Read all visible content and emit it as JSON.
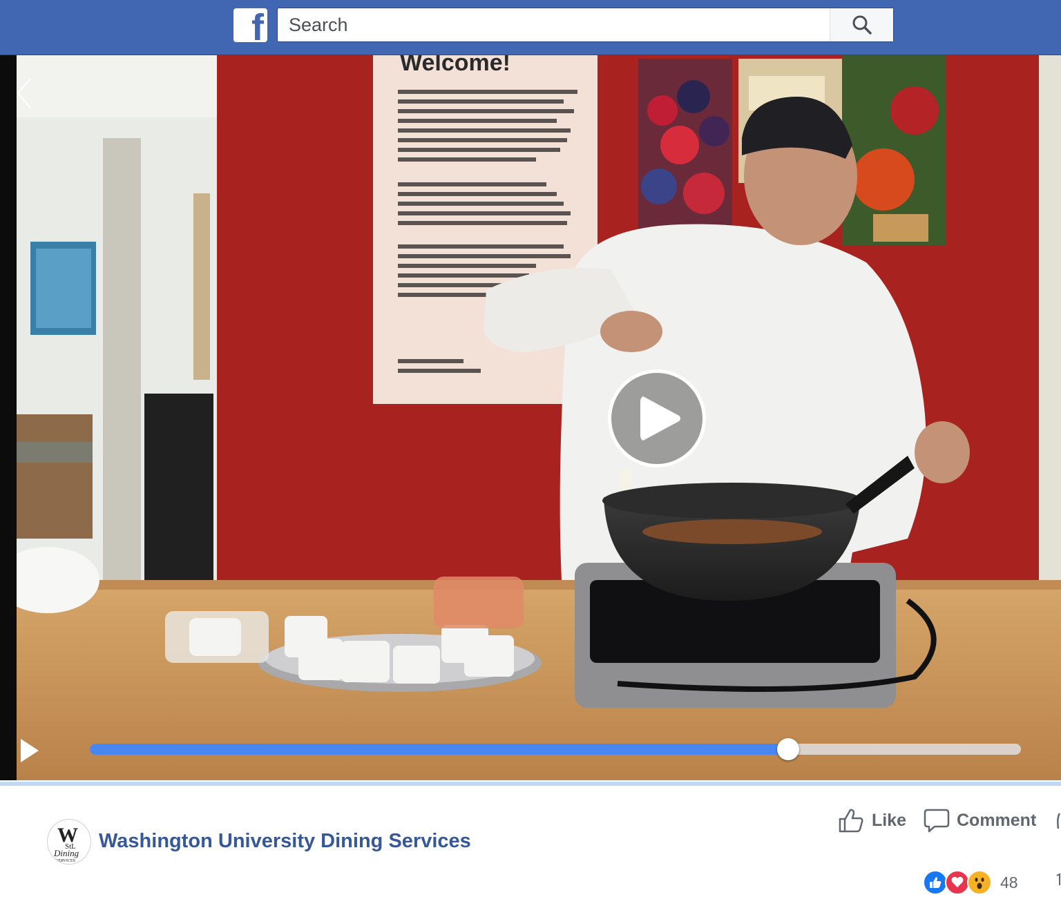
{
  "topbar": {
    "logo_glyph": "f",
    "search": {
      "placeholder": "Search",
      "value": ""
    },
    "search_icon": "search-icon"
  },
  "video": {
    "description_icon": "play-icon",
    "progress": 0.75,
    "progress_color": "#4a86f0",
    "overlay_controls": [
      "back-arrow-icon",
      "play-icon",
      "play-icon"
    ]
  },
  "post": {
    "page_name": "Washington University Dining Services",
    "avatar_icon": "wustl-dining-logo",
    "actions": {
      "like": "Like",
      "comment": "Comment"
    },
    "reactions": {
      "icons": [
        "like-reaction-icon",
        "love-reaction-icon",
        "wow-reaction-icon"
      ],
      "count": "48"
    }
  },
  "colors": {
    "brand": "#4267b2",
    "link": "#365899",
    "muted": "#606770"
  }
}
